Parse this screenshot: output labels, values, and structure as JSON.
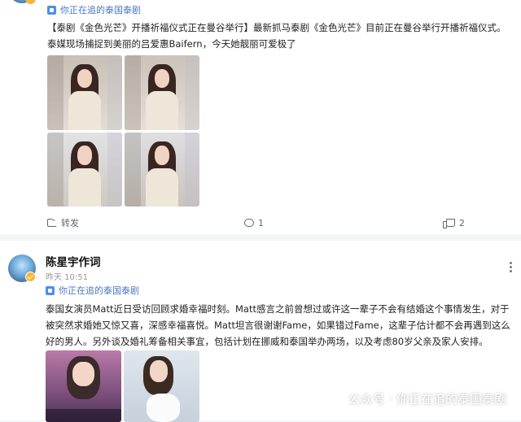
{
  "post1": {
    "topic": "你正在追的泰国泰剧",
    "text": "【泰剧《金色光芒》开播祈福仪式正在曼谷举行】最新抓马泰剧《金色光芒》目前正在曼谷举行开播祈福仪式。泰媒现场捕捉到美丽的吕爱惠Baifern，今天她靓丽可爱极了",
    "images": [
      "photo-1",
      "photo-2",
      "photo-3",
      "photo-4"
    ],
    "actions": {
      "share_label": "转发",
      "comment_count": "1",
      "like_count": "2"
    }
  },
  "post2": {
    "user_name": "陈星宇作词",
    "time": "昨天 10:51",
    "topic": "你正在追的泰国泰剧",
    "text": "泰国女演员Matt近日受访回顾求婚幸福时刻。Matt感言之前曾想过或许这一辈子不会有结婚这个事情发生，对于被突然求婚她又惊又喜，深感幸福喜悦。Matt坦言很谢谢Fame，如果错过Fame，这辈子估计都不会再遇到这么好的男人。另外谈及婚礼筹备相关事宜，包括计划在挪威和泰国举办两场，以及考虑80岁父亲及家人安排。",
    "images": [
      "photo-1",
      "photo-2"
    ]
  },
  "watermark": {
    "text": "公众号 · 你正在追的泰国泰剧"
  },
  "colors": {
    "link_blue": "#4a78c2",
    "tag_icon_blue": "#4a90e2",
    "badge_gold": "#f5b83d"
  }
}
